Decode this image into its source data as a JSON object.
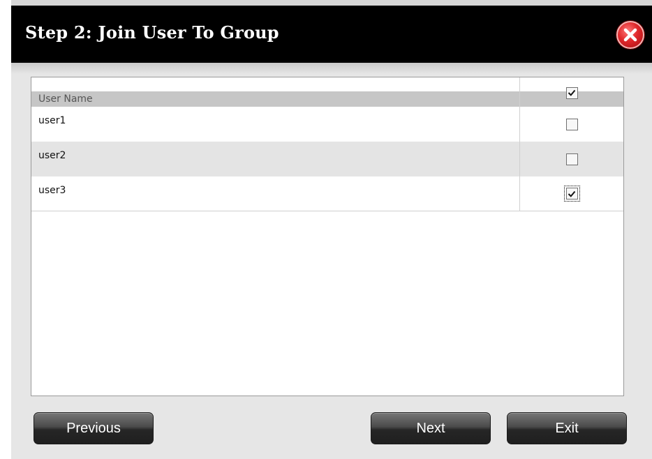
{
  "dialog": {
    "title": "Step 2: Join User To Group"
  },
  "table": {
    "header": {
      "name_label": "User Name",
      "select_all_checked": true
    },
    "rows": [
      {
        "name": "user1",
        "checked": false
      },
      {
        "name": "user2",
        "checked": false
      },
      {
        "name": "user3",
        "checked": true
      }
    ]
  },
  "buttons": {
    "previous": "Previous",
    "next": "Next",
    "exit": "Exit"
  },
  "icons": {
    "close": "close-icon",
    "check": "check-icon"
  },
  "colors": {
    "close_red": "#e0282b",
    "titlebar": "#000000",
    "row_alt": "#e4e4e4"
  }
}
